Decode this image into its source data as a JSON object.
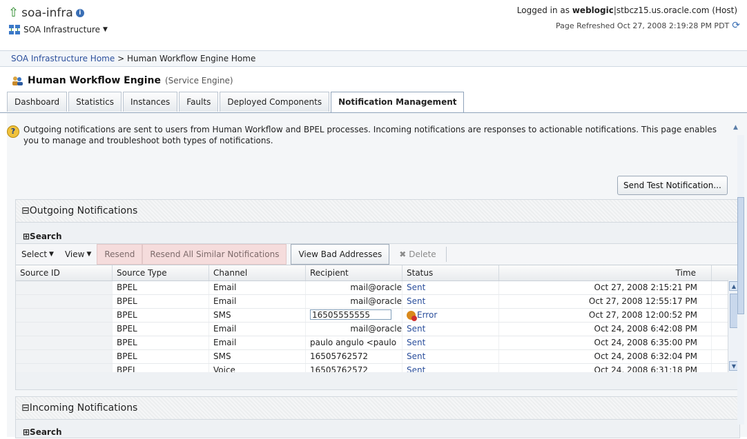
{
  "header": {
    "app_title": "soa-infra",
    "menu_label": "SOA Infrastructure",
    "login_prefix": "Logged in as",
    "login_user": "weblogic",
    "login_host": "|stbcz15.us.oracle.com (Host)",
    "refreshed": "Page Refreshed Oct 27, 2008 2:19:28 PM PDT"
  },
  "breadcrumb": {
    "link": "SOA Infrastructure Home",
    "separator": " > ",
    "current": "Human Workflow Engine Home"
  },
  "engine": {
    "title": "Human Workflow Engine",
    "subtitle": "(Service Engine)"
  },
  "tabs": [
    {
      "label": "Dashboard"
    },
    {
      "label": "Statistics"
    },
    {
      "label": "Instances"
    },
    {
      "label": "Faults"
    },
    {
      "label": "Deployed Components"
    },
    {
      "label": "Notification Management"
    }
  ],
  "help_text": "Outgoing notifications are sent to users from Human Workflow and BPEL processes. Incoming notifications are responses to actionable notifications. This page enables you to manage and troubleshoot both types of notifications.",
  "send_test_label": "Send Test Notification...",
  "outgoing": {
    "title": "⊟Outgoing Notifications",
    "search_label": "⊞Search",
    "toolbar": {
      "select": "Select",
      "view": "View",
      "resend": "Resend",
      "resend_all": "Resend All Similar Notifications",
      "view_bad": "View Bad Addresses",
      "delete": "Delete"
    },
    "columns": [
      "Source ID",
      "Source Type",
      "Channel",
      "Recipient",
      "Status",
      "Time"
    ],
    "rows": [
      {
        "source_id": "",
        "source_type": "BPEL",
        "channel": "Email",
        "recipient": "mail@oracle",
        "status": "Sent",
        "time": "Oct 27, 2008 2:15:21 PM"
      },
      {
        "source_id": "",
        "source_type": "BPEL",
        "channel": "Email",
        "recipient": "mail@oracle",
        "status": "Sent",
        "time": "Oct 27, 2008 12:55:17 PM"
      },
      {
        "source_id": "",
        "source_type": "BPEL",
        "channel": "SMS",
        "recipient": "16505555555",
        "status": "Error",
        "time": "Oct 27, 2008 12:00:52 PM"
      },
      {
        "source_id": "",
        "source_type": "BPEL",
        "channel": "Email",
        "recipient": "mail@oracle",
        "status": "Sent",
        "time": "Oct 24, 2008 6:42:08 PM"
      },
      {
        "source_id": "",
        "source_type": "BPEL",
        "channel": "Email",
        "recipient": "paulo angulo <paulo",
        "status": "Sent",
        "time": "Oct 24, 2008 6:35:00 PM"
      },
      {
        "source_id": "",
        "source_type": "BPEL",
        "channel": "SMS",
        "recipient": "16505762572",
        "status": "Sent",
        "time": "Oct 24, 2008 6:32:04 PM"
      },
      {
        "source_id": "",
        "source_type": "BPEL",
        "channel": "Voice",
        "recipient": "16505762572",
        "status": "Sent",
        "time": "Oct 24, 2008 6:31:18 PM"
      }
    ]
  },
  "incoming": {
    "title": "⊟Incoming Notifications",
    "search_label": "⊞Search"
  }
}
